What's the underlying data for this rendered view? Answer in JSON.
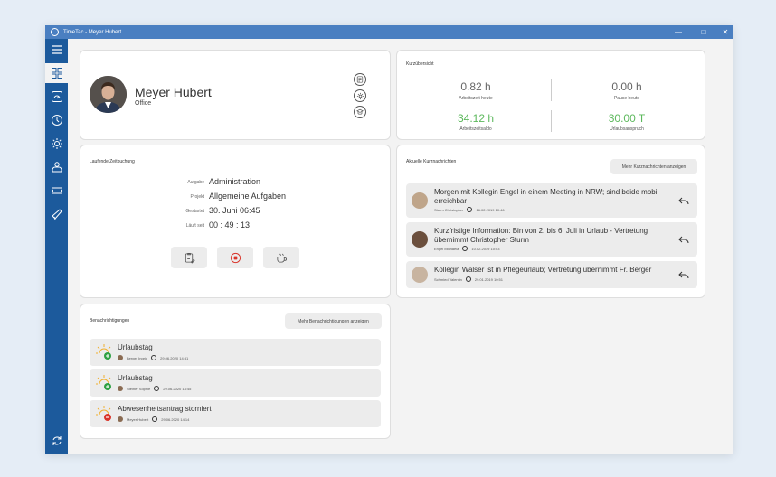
{
  "window": {
    "title": "TimeTac - Meyer Hubert"
  },
  "profile": {
    "name": "Meyer Hubert",
    "location": "Office"
  },
  "overview": {
    "title": "Kurzübersicht",
    "items": [
      {
        "value": "0.82 h",
        "label": "Arbeitszeit heute",
        "color": "#666666"
      },
      {
        "value": "0.00 h",
        "label": "Pause heute",
        "color": "#666666"
      },
      {
        "value": "34.12 h",
        "label": "Arbeitszeitsaldo",
        "color": "#5cb85c"
      },
      {
        "value": "30.00 T",
        "label": "Urlaubsanspruch",
        "color": "#5cb85c"
      }
    ]
  },
  "booking": {
    "title": "Laufende Zeitbuchung",
    "rows": [
      {
        "label": "Aufgabe",
        "value": "Administration"
      },
      {
        "label": "Projekt",
        "value": "Allgemeine Aufgaben"
      },
      {
        "label": "Gestartet",
        "value": "30. Juni 06:45"
      },
      {
        "label": "Läuft seit",
        "value": "00 : 49 : 13"
      }
    ]
  },
  "news": {
    "title": "Aktuelle Kurznachrichten",
    "more_label": "Mehr Kurznachrichten anzeigen",
    "items": [
      {
        "text": "Morgen mit Kollegin Engel in einem Meeting in NRW; sind beide mobil erreichbar",
        "author": "Sturm Christopher",
        "date": "16.02.2019 10:46"
      },
      {
        "text": "Kurzfristige Information: Bin von 2. bis 6. Juli in Urlaub - Vertretung übernimmt Christopher Sturm",
        "author": "Engel Michaela",
        "date": "10.02.2019 10:03"
      },
      {
        "text": "Kollegin Walser ist in Pflegeurlaub; Vertretung übernimmt Fr. Berger",
        "author": "Schmied Valentin",
        "date": "29.01.2019 10:51"
      }
    ]
  },
  "notifications": {
    "title": "Benachrichtigungen",
    "more_label": "Mehr Benachrichtigungen anzeigen",
    "items": [
      {
        "title": "Urlaubstag",
        "person": "Berger Ingrid",
        "date": "29.06.2020 14:51",
        "status": "approved"
      },
      {
        "title": "Urlaubstag",
        "person": "Steiner Sophie",
        "date": "29.06.2020 14:45",
        "status": "approved"
      },
      {
        "title": "Abwesenheitsantrag storniert",
        "person": "Meyer Hubert",
        "date": "29.06.2020 14:14",
        "status": "cancelled"
      }
    ]
  },
  "colors": {
    "titlebar": "#4a7fc1",
    "sidebar": "#1c5a9c",
    "green": "#5cb85c",
    "red": "#d9352b"
  }
}
